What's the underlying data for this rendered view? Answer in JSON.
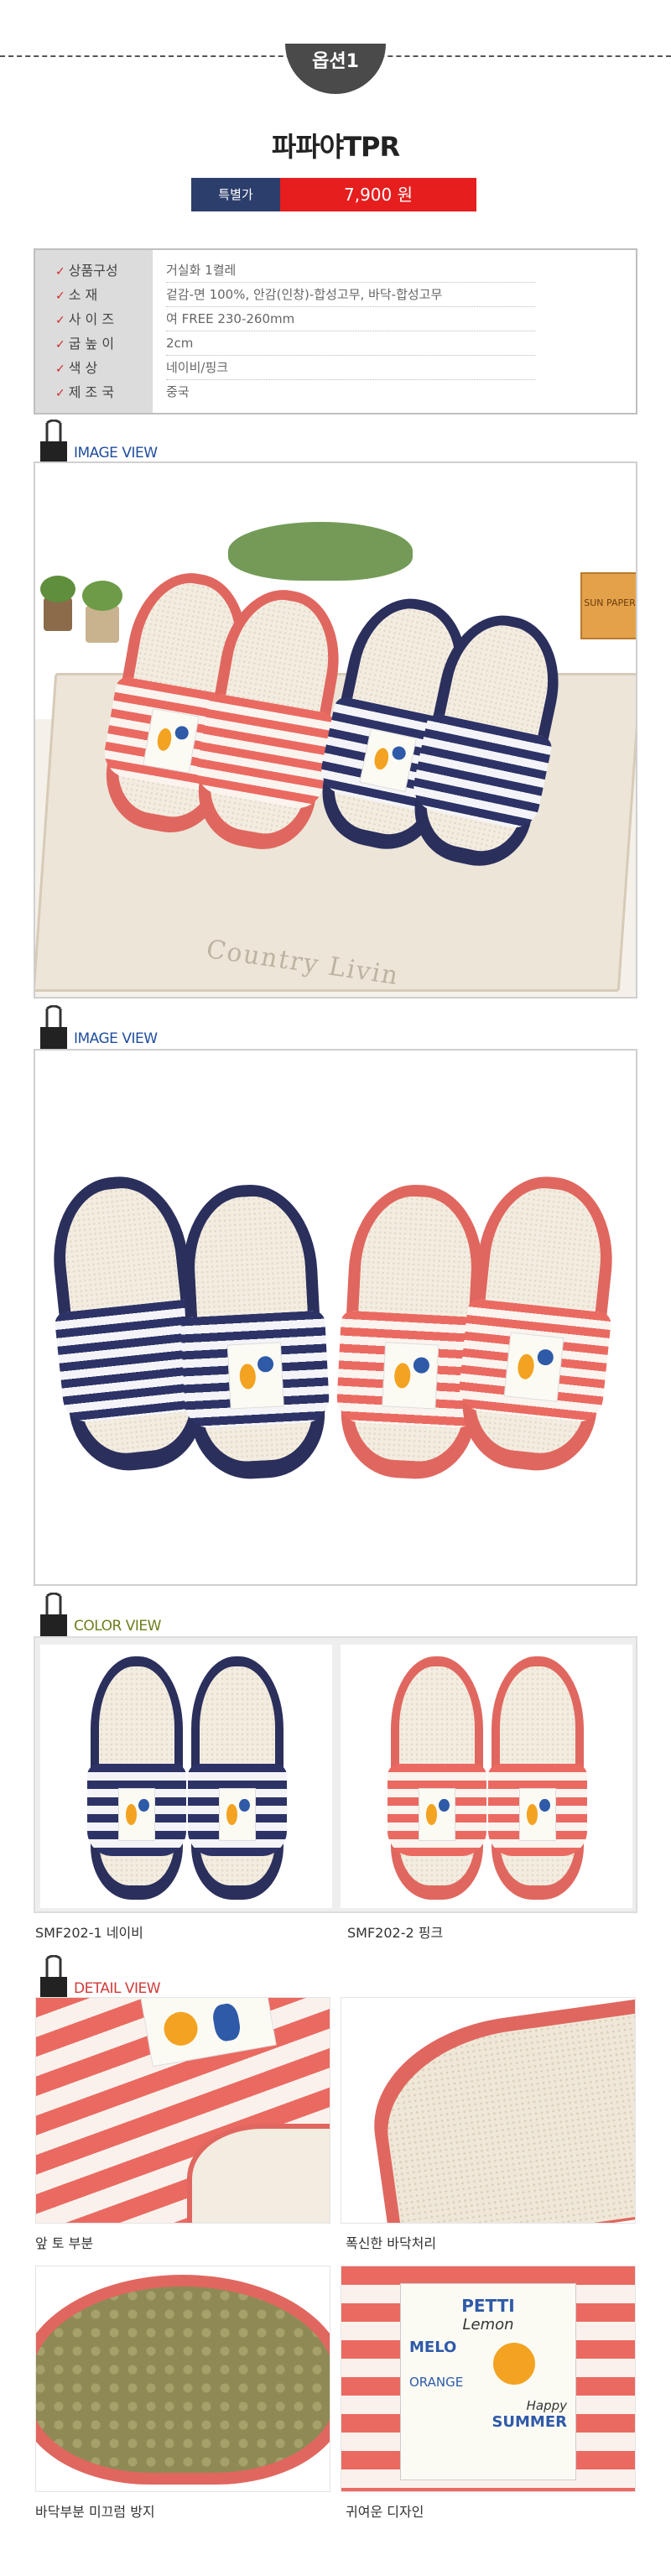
{
  "option_tab": "옵션1",
  "product": {
    "name": "파파야TPR",
    "price_label": "특별가",
    "price": "7,900 원"
  },
  "specs": {
    "keys": [
      "상품구성",
      "소    재",
      "사 이 즈",
      "굽 높 이",
      "색    상",
      "제 조 국"
    ],
    "values": [
      "거실화 1켤레",
      "겉감-면 100%, 안감(인창)-합성고무, 바닥-합성고무",
      "여 FREE 230-260mm",
      "2cm",
      "네이비/핑크",
      "중국"
    ]
  },
  "sections": {
    "image_view_1": "IMAGE VIEW",
    "image_view_2": "IMAGE VIEW",
    "color_view": "COLOR VIEW",
    "detail_view": "DETAIL VIEW"
  },
  "scene_text": {
    "tray_text": "Country Livin",
    "box_text": "SUN PAPER"
  },
  "color_options": [
    {
      "label": "SMF202-1 네이비"
    },
    {
      "label": "SMF202-2 핑크"
    }
  ],
  "details": [
    {
      "label": "앞 토 부분"
    },
    {
      "label": "폭신한 바닥처리"
    },
    {
      "label": "바닥부분 미끄럼 방지"
    },
    {
      "label": "귀여운 디자인"
    }
  ],
  "patch_text": [
    "PETTI",
    "Lemon",
    "MELO",
    "ORANGE",
    "Happy",
    "SUMMER"
  ],
  "colors": {
    "navy": "#2b2f5c",
    "pink": "#e0675f",
    "price_red": "#e61e1e",
    "price_navy": "#2c3e6b"
  }
}
